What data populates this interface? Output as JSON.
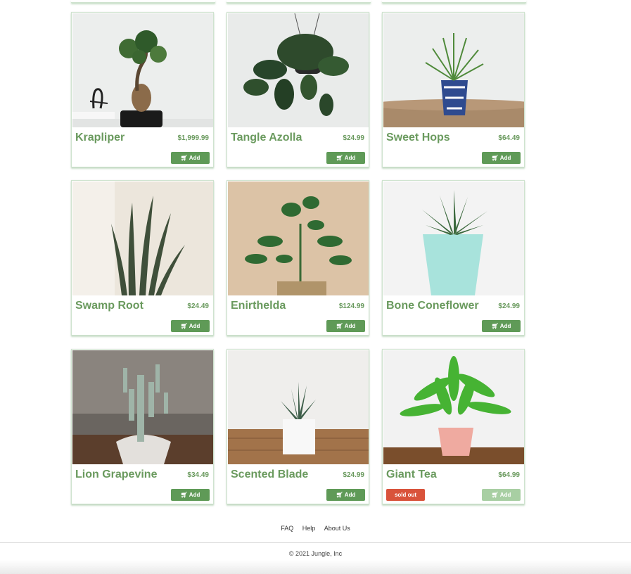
{
  "products": [
    {
      "name": "Krapliper",
      "price": "$1,999.99",
      "add_label": "Add",
      "sold_out": false,
      "photo": "bonsai-plant"
    },
    {
      "name": "Tangle Azolla",
      "price": "$24.99",
      "add_label": "Add",
      "sold_out": false,
      "photo": "hanging-pothos"
    },
    {
      "name": "Sweet Hops",
      "price": "$64.49",
      "add_label": "Add",
      "sold_out": false,
      "photo": "palm-blue-pot"
    },
    {
      "name": "Swamp Root",
      "price": "$24.49",
      "add_label": "Add",
      "sold_out": false,
      "photo": "snake-plant"
    },
    {
      "name": "Enirthelda",
      "price": "$124.99",
      "add_label": "Add",
      "sold_out": false,
      "photo": "jade-basket"
    },
    {
      "name": "Bone Coneflower",
      "price": "$24.99",
      "add_label": "Add",
      "sold_out": false,
      "photo": "aloe-mint-pot"
    },
    {
      "name": "Lion Grapevine",
      "price": "$34.49",
      "add_label": "Add",
      "sold_out": false,
      "photo": "cactus-white-pot"
    },
    {
      "name": "Scented Blade",
      "price": "$24.99",
      "add_label": "Add",
      "sold_out": false,
      "photo": "succulent-white-box"
    },
    {
      "name": "Giant Tea",
      "price": "$64.99",
      "add_label": "Add",
      "sold_out": true,
      "sold_out_label": "sold out",
      "photo": "fern-pink-pot"
    }
  ],
  "icons": {
    "cart": "cart-icon"
  },
  "footer": {
    "links": [
      "FAQ",
      "Help",
      "About Us"
    ],
    "copyright": "© 2021 Jungle, Inc"
  },
  "colors": {
    "accent": "#5f9a57",
    "title": "#6a9a5e",
    "sold_out": "#d9533b"
  }
}
